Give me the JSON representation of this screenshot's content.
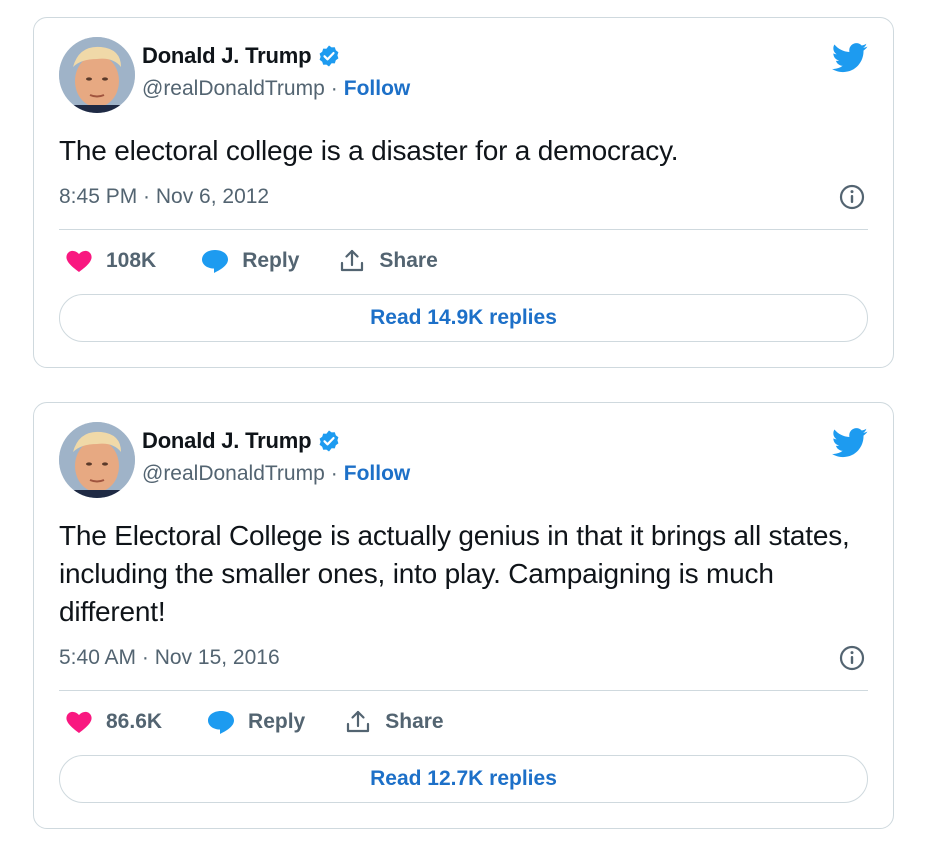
{
  "colors": {
    "accent": "#1d9bf0",
    "link": "#1d70c8",
    "like": "#f91880",
    "secondary_text": "#536471",
    "border": "#cfd9de"
  },
  "tweets": [
    {
      "author": {
        "name": "Donald J. Trump",
        "handle": "@realDonaldTrump",
        "follow_label": "Follow",
        "separator": "·",
        "verified": true
      },
      "text": "The electoral college is a disaster for a democracy.",
      "timestamp": "8:45 PM · Nov 6, 2012",
      "likes": "108K",
      "reply_label": "Reply",
      "share_label": "Share",
      "read_replies_label": "Read 14.9K replies",
      "icons": [
        "twitter-bird-icon",
        "verified-badge-icon",
        "info-icon",
        "heart-icon",
        "reply-bubble-icon",
        "share-icon"
      ]
    },
    {
      "author": {
        "name": "Donald J. Trump",
        "handle": "@realDonaldTrump",
        "follow_label": "Follow",
        "separator": "·",
        "verified": true
      },
      "text": "The Electoral College is actually genius in that it brings all states, including the smaller ones, into play. Campaigning is much different!",
      "timestamp": "5:40 AM · Nov 15, 2016",
      "likes": "86.6K",
      "reply_label": "Reply",
      "share_label": "Share",
      "read_replies_label": "Read 12.7K replies",
      "icons": [
        "twitter-bird-icon",
        "verified-badge-icon",
        "info-icon",
        "heart-icon",
        "reply-bubble-icon",
        "share-icon"
      ]
    }
  ]
}
